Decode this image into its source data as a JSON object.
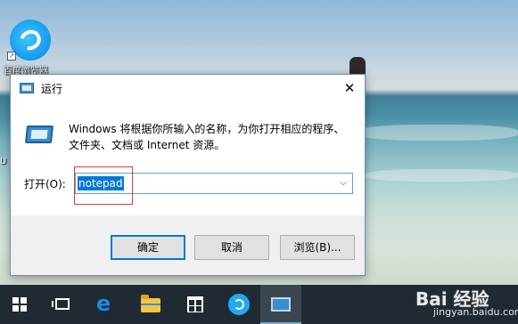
{
  "desktop": {
    "icon_label": "百度浏览器",
    "left_peek_1": "U",
    "left_peek_2": "»"
  },
  "dialog": {
    "title": "运行",
    "close_glyph": "✕",
    "description": "Windows 将根据你所输入的名称，为你打开相应的程序、文件夹、文档或 Internet 资源。",
    "open_label": "打开(O):",
    "open_value": "notepad",
    "dropdown_glyph": "⌵",
    "buttons": {
      "ok": "确定",
      "cancel": "取消",
      "browse": "浏览(B)..."
    }
  },
  "taskbar": {
    "items": [
      "start-icon",
      "task-view-icon",
      "edge-icon",
      "file-explorer-icon",
      "store-icon",
      "baidu-browser-icon",
      "run-icon"
    ],
    "active_item": "run-icon"
  },
  "watermark": {
    "brand": "Bai 经验",
    "url": "jingyan.baidu.com"
  }
}
